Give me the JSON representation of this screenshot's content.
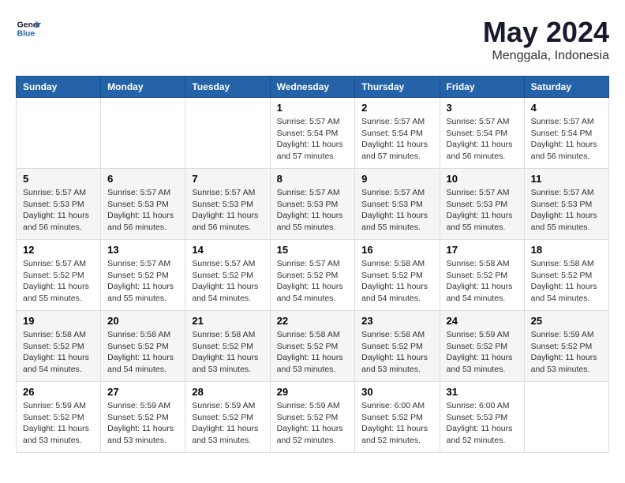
{
  "header": {
    "logo_line1": "General",
    "logo_line2": "Blue",
    "title": "May 2024",
    "subtitle": "Menggala, Indonesia"
  },
  "days_of_week": [
    "Sunday",
    "Monday",
    "Tuesday",
    "Wednesday",
    "Thursday",
    "Friday",
    "Saturday"
  ],
  "weeks": [
    [
      {
        "day": "",
        "info": ""
      },
      {
        "day": "",
        "info": ""
      },
      {
        "day": "",
        "info": ""
      },
      {
        "day": "1",
        "info": "Sunrise: 5:57 AM\nSunset: 5:54 PM\nDaylight: 11 hours and 57 minutes."
      },
      {
        "day": "2",
        "info": "Sunrise: 5:57 AM\nSunset: 5:54 PM\nDaylight: 11 hours and 57 minutes."
      },
      {
        "day": "3",
        "info": "Sunrise: 5:57 AM\nSunset: 5:54 PM\nDaylight: 11 hours and 56 minutes."
      },
      {
        "day": "4",
        "info": "Sunrise: 5:57 AM\nSunset: 5:54 PM\nDaylight: 11 hours and 56 minutes."
      }
    ],
    [
      {
        "day": "5",
        "info": "Sunrise: 5:57 AM\nSunset: 5:53 PM\nDaylight: 11 hours and 56 minutes."
      },
      {
        "day": "6",
        "info": "Sunrise: 5:57 AM\nSunset: 5:53 PM\nDaylight: 11 hours and 56 minutes."
      },
      {
        "day": "7",
        "info": "Sunrise: 5:57 AM\nSunset: 5:53 PM\nDaylight: 11 hours and 56 minutes."
      },
      {
        "day": "8",
        "info": "Sunrise: 5:57 AM\nSunset: 5:53 PM\nDaylight: 11 hours and 55 minutes."
      },
      {
        "day": "9",
        "info": "Sunrise: 5:57 AM\nSunset: 5:53 PM\nDaylight: 11 hours and 55 minutes."
      },
      {
        "day": "10",
        "info": "Sunrise: 5:57 AM\nSunset: 5:53 PM\nDaylight: 11 hours and 55 minutes."
      },
      {
        "day": "11",
        "info": "Sunrise: 5:57 AM\nSunset: 5:53 PM\nDaylight: 11 hours and 55 minutes."
      }
    ],
    [
      {
        "day": "12",
        "info": "Sunrise: 5:57 AM\nSunset: 5:52 PM\nDaylight: 11 hours and 55 minutes."
      },
      {
        "day": "13",
        "info": "Sunrise: 5:57 AM\nSunset: 5:52 PM\nDaylight: 11 hours and 55 minutes."
      },
      {
        "day": "14",
        "info": "Sunrise: 5:57 AM\nSunset: 5:52 PM\nDaylight: 11 hours and 54 minutes."
      },
      {
        "day": "15",
        "info": "Sunrise: 5:57 AM\nSunset: 5:52 PM\nDaylight: 11 hours and 54 minutes."
      },
      {
        "day": "16",
        "info": "Sunrise: 5:58 AM\nSunset: 5:52 PM\nDaylight: 11 hours and 54 minutes."
      },
      {
        "day": "17",
        "info": "Sunrise: 5:58 AM\nSunset: 5:52 PM\nDaylight: 11 hours and 54 minutes."
      },
      {
        "day": "18",
        "info": "Sunrise: 5:58 AM\nSunset: 5:52 PM\nDaylight: 11 hours and 54 minutes."
      }
    ],
    [
      {
        "day": "19",
        "info": "Sunrise: 5:58 AM\nSunset: 5:52 PM\nDaylight: 11 hours and 54 minutes."
      },
      {
        "day": "20",
        "info": "Sunrise: 5:58 AM\nSunset: 5:52 PM\nDaylight: 11 hours and 54 minutes."
      },
      {
        "day": "21",
        "info": "Sunrise: 5:58 AM\nSunset: 5:52 PM\nDaylight: 11 hours and 53 minutes."
      },
      {
        "day": "22",
        "info": "Sunrise: 5:58 AM\nSunset: 5:52 PM\nDaylight: 11 hours and 53 minutes."
      },
      {
        "day": "23",
        "info": "Sunrise: 5:58 AM\nSunset: 5:52 PM\nDaylight: 11 hours and 53 minutes."
      },
      {
        "day": "24",
        "info": "Sunrise: 5:59 AM\nSunset: 5:52 PM\nDaylight: 11 hours and 53 minutes."
      },
      {
        "day": "25",
        "info": "Sunrise: 5:59 AM\nSunset: 5:52 PM\nDaylight: 11 hours and 53 minutes."
      }
    ],
    [
      {
        "day": "26",
        "info": "Sunrise: 5:59 AM\nSunset: 5:52 PM\nDaylight: 11 hours and 53 minutes."
      },
      {
        "day": "27",
        "info": "Sunrise: 5:59 AM\nSunset: 5:52 PM\nDaylight: 11 hours and 53 minutes."
      },
      {
        "day": "28",
        "info": "Sunrise: 5:59 AM\nSunset: 5:52 PM\nDaylight: 11 hours and 53 minutes."
      },
      {
        "day": "29",
        "info": "Sunrise: 5:59 AM\nSunset: 5:52 PM\nDaylight: 11 hours and 52 minutes."
      },
      {
        "day": "30",
        "info": "Sunrise: 6:00 AM\nSunset: 5:52 PM\nDaylight: 11 hours and 52 minutes."
      },
      {
        "day": "31",
        "info": "Sunrise: 6:00 AM\nSunset: 5:53 PM\nDaylight: 11 hours and 52 minutes."
      },
      {
        "day": "",
        "info": ""
      }
    ]
  ]
}
